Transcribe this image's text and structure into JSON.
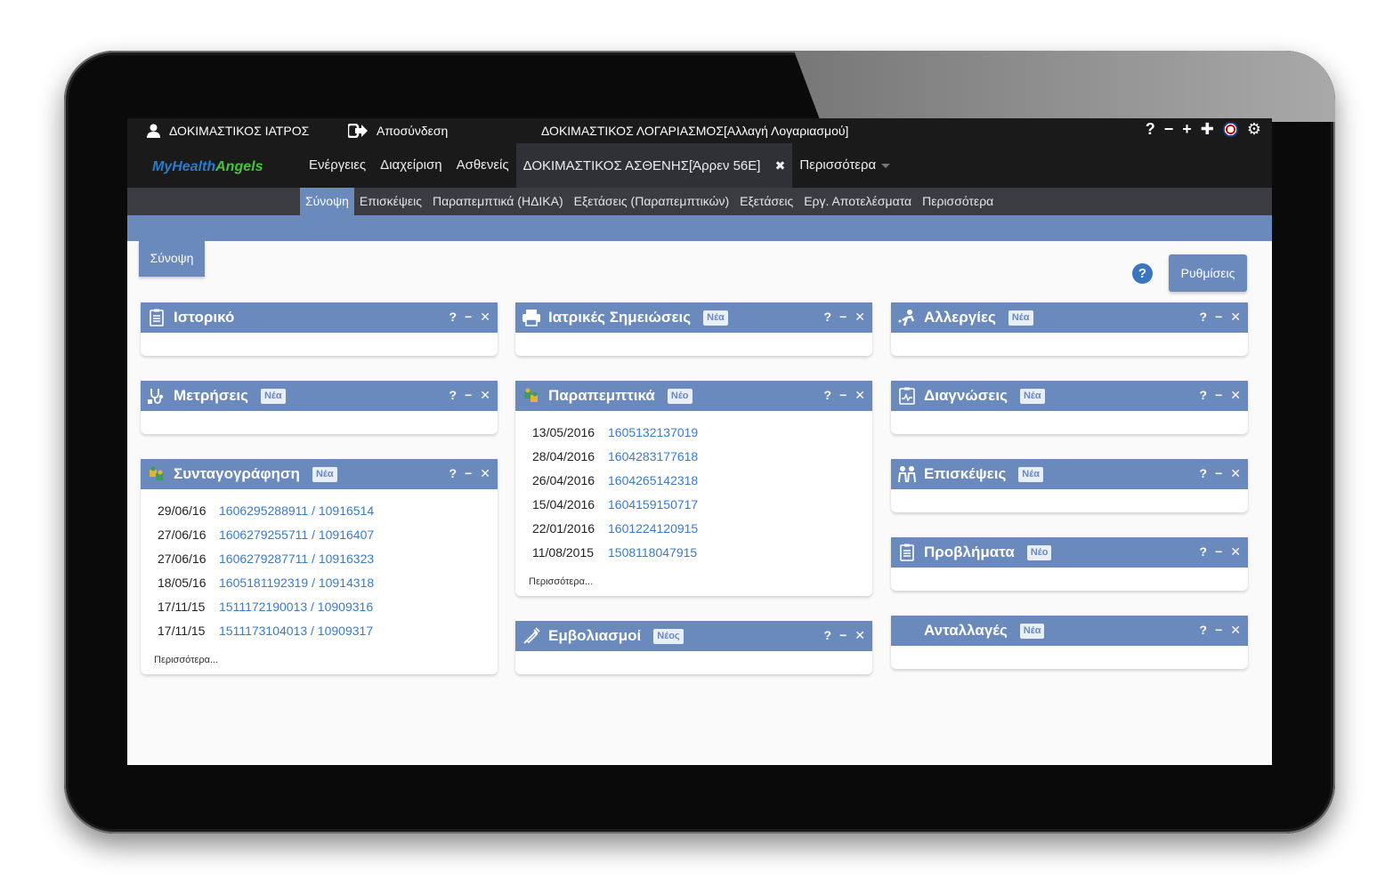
{
  "topbar": {
    "user": "ΔΟΚΙΜΑΣΤΙΚΟΣ ΙΑΤΡΟΣ",
    "logout": "Αποσύνδεση",
    "account": "ΔΟΚΙΜΑΣΤΙΚΟΣ ΛΟΓΑΡΙΑΣΜΟΣ[Αλλαγή Λογαριασμού]",
    "help_glyph": "?",
    "minus_glyph": "−",
    "plus_glyph": "+",
    "plus_bold_glyph": "✚",
    "gear_glyph": "⚙"
  },
  "logo": {
    "part1": "MyHealth",
    "part2": "Angels"
  },
  "nav": {
    "items": [
      "Ενέργειες",
      "Διαχείριση",
      "Ασθενείς"
    ],
    "patient_tab": "ΔΟΚΙΜΑΣΤΙΚΟΣ ΑΣΘΕΝΗΣ[Άρρεν 56Ε]",
    "close_glyph": "✖",
    "more": "Περισσότερα"
  },
  "subnav": {
    "items": [
      "Σύνοψη",
      "Επισκέψεις",
      "Παραπεμπτικά (ΗΔΙΚΑ)",
      "Εξετάσεις (Παραπεμπτικών)",
      "Εξετάσεις",
      "Εργ. Αποτελέσματα",
      "Περισσότερα"
    ]
  },
  "page": {
    "tab": "Σύνοψη",
    "help": "?",
    "settings": "Ρυθμίσεις"
  },
  "widget_controls": {
    "help": "?",
    "minimize": "−",
    "close": "✕"
  },
  "widgets": {
    "history": {
      "title": "Ιστορικό",
      "icon": "clipboard-icon"
    },
    "measurements": {
      "title": "Μετρήσεις",
      "badge": "Νέα",
      "icon": "stethoscope-icon"
    },
    "prescriptions": {
      "title": "Συνταγογράφηση",
      "badge": "Νέα",
      "icon": "puzzle-icon",
      "rows": [
        {
          "date": "29/06/16",
          "value": "1606295288911 / 10916514"
        },
        {
          "date": "27/06/16",
          "value": "1606279255711 / 10916407"
        },
        {
          "date": "27/06/16",
          "value": "1606279287711 / 10916323"
        },
        {
          "date": "18/05/16",
          "value": "1605181192319 / 10914318"
        },
        {
          "date": "17/11/15",
          "value": "1511172190013 / 10909316"
        },
        {
          "date": "17/11/15",
          "value": "1511173104013 / 10909317"
        }
      ],
      "more": "Περισσότερα..."
    },
    "notes": {
      "title": "Ιατρικές Σημειώσεις",
      "badge": "Νέα",
      "icon": "printer-icon"
    },
    "referrals": {
      "title": "Παραπεμπτικά",
      "badge": "Νέο",
      "icon": "puzzle-icon",
      "rows": [
        {
          "date": "13/05/2016",
          "value": "1605132137019"
        },
        {
          "date": "28/04/2016",
          "value": "1604283177618"
        },
        {
          "date": "26/04/2016",
          "value": "1604265142318"
        },
        {
          "date": "15/04/2016",
          "value": "1604159150717"
        },
        {
          "date": "22/01/2016",
          "value": "1601224120915"
        },
        {
          "date": "11/08/2015",
          "value": "1508118047915"
        }
      ],
      "more": "Περισσότερα..."
    },
    "vaccinations": {
      "title": "Εμβολιασμοί",
      "badge": "Νέος",
      "icon": "syringe-icon"
    },
    "allergies": {
      "title": "Αλλεργίες",
      "badge": "Νέα",
      "icon": "allergy-icon"
    },
    "diagnoses": {
      "title": "Διαγνώσεις",
      "badge": "Νέα",
      "icon": "diagnosis-icon"
    },
    "visits": {
      "title": "Επισκέψεις",
      "badge": "Νέα",
      "icon": "people-icon"
    },
    "problems": {
      "title": "Προβλήματα",
      "badge": "Νέο",
      "icon": "clipboard-icon"
    },
    "exchanges": {
      "title": "Ανταλλαγές",
      "badge": "Νέα"
    }
  }
}
